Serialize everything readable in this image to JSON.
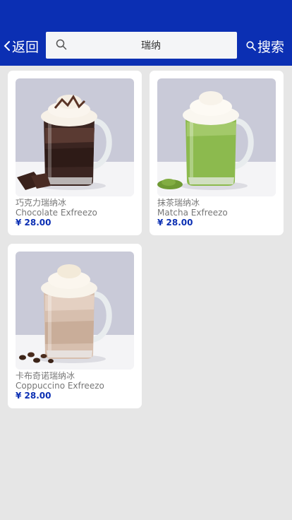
{
  "header": {
    "back_label": "返回",
    "search_value": "瑞纳",
    "search_button_label": "搜索"
  },
  "colors": {
    "brand_blue": "#0b2fb3",
    "page_bg": "#e6e6e6"
  },
  "products": [
    {
      "name_cn": "巧克力瑞纳冰",
      "name_en": "Chocolate Exfreezo",
      "price": "¥ 28.00",
      "image": "chocolate-exfreezo-image"
    },
    {
      "name_cn": "抹茶瑞纳冰",
      "name_en": "Matcha Exfreezo",
      "price": "¥ 28.00",
      "image": "matcha-exfreezo-image"
    },
    {
      "name_cn": "卡布奇诺瑞纳冰",
      "name_en": "Coppuccino Exfreezo",
      "price": "¥ 28.00",
      "image": "coppuccino-exfreezo-image"
    }
  ]
}
